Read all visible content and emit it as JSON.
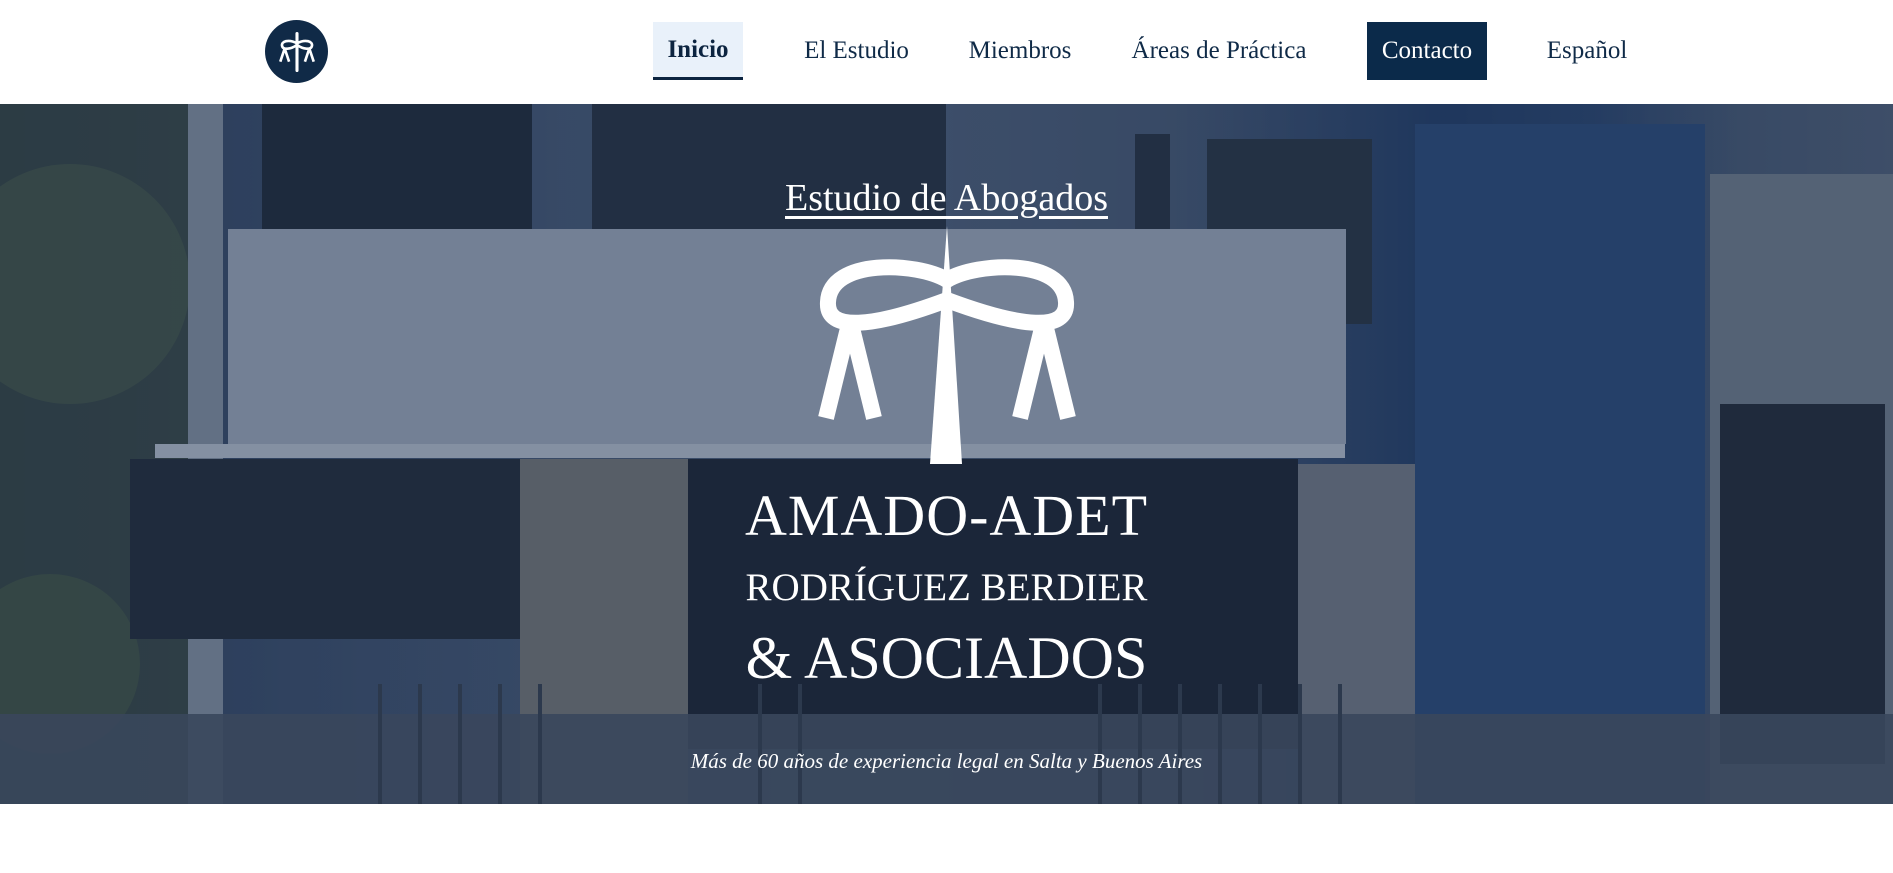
{
  "nav": {
    "items": [
      {
        "label": "Inicio",
        "state": "active"
      },
      {
        "label": "El Estudio"
      },
      {
        "label": "Miembros"
      },
      {
        "label": "Áreas de Práctica"
      },
      {
        "label": "Contacto",
        "state": "cta"
      },
      {
        "label": "Español"
      }
    ]
  },
  "hero": {
    "eyebrow": "Estudio de Abogados",
    "line1": "AMADO-ADET",
    "line2": "RODRÍGUEZ BERDIER",
    "line3": "& ASOCIADOS",
    "tagline": "Más de 60 años de experiencia legal en Salta y Buenos Aires"
  },
  "icons": {
    "logo": "scales-of-justice-icon",
    "hero_mark": "scales-of-justice-icon"
  },
  "colors": {
    "brand_navy": "#0b2a4a",
    "active_tab_bg": "#e9f1fa",
    "text": "#0f2a47",
    "white": "#ffffff"
  }
}
